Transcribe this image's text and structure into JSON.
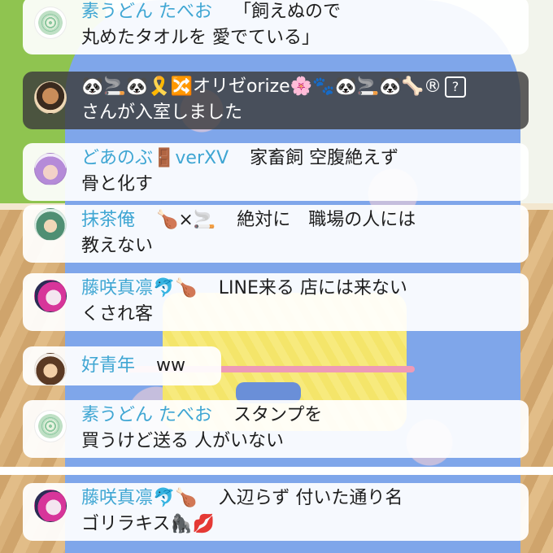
{
  "messages": [
    {
      "user": "素うどん たべお",
      "text": "「飼えぬので",
      "text2": "丸めたタオルを 愛でている」"
    },
    {
      "system_user": "🐼🚬🐼🎗️🔀オリゼorize🌸🐾🐼🚬🐼🦴®",
      "badge": "?",
      "system_text": "さんが入室しました"
    },
    {
      "user": "どあのぶ🚪verXV",
      "text": "家畜飼 空腹絶えず",
      "text2": "骨と化す"
    },
    {
      "user": "抹茶俺",
      "emoji": "🍗×🚬",
      "text": "絶対に　職場の人には",
      "text2": "教えない"
    },
    {
      "user": "藤咲真凛🐬🍗",
      "text": "LINE来る 店には来ない",
      "text2": "くされ客"
    },
    {
      "user": "好青年",
      "text": "ww"
    },
    {
      "user": "素うどん たべお",
      "text": "スタンプを",
      "text2": "買うけど送る 人がいない"
    },
    {
      "user": "藤咲真凛🐬🍗",
      "text": "入辺らず 付いた通り名",
      "text2": "ゴリラキス🦍💋"
    }
  ],
  "colors": {
    "name": "#3fa6d3",
    "bubble": "#ffffff",
    "system_bubble": "#3c3c3c"
  },
  "icons": [
    "leaf-avatar-icon",
    "man-avatar-icon",
    "purple-hair-avatar-icon",
    "green-hair-avatar-icon",
    "pink-hair-avatar-icon",
    "brown-hair-avatar-icon"
  ]
}
